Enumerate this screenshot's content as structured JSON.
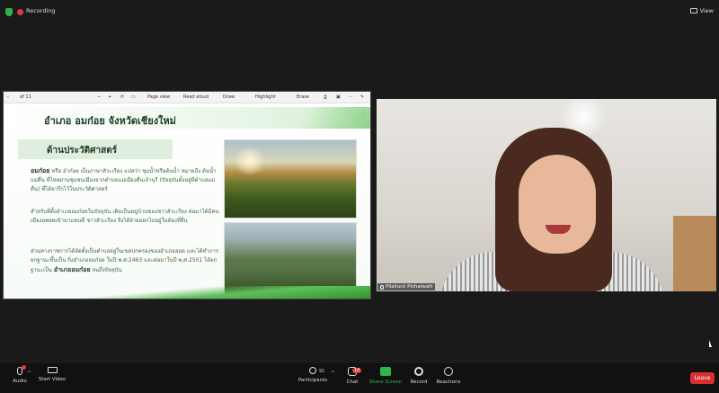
{
  "topbar": {
    "recording_label": "Recording",
    "view_label": "View"
  },
  "pdf_toolbar": {
    "page_indicator": "of 11",
    "page_view": "Page view",
    "read_aloud": "Read aloud",
    "draw": "Draw",
    "highlight": "Highlight",
    "erase": "Erase"
  },
  "slide": {
    "title": "อำเภอ อมก๋อย จังหวัดเชียงใหม่",
    "section": "ด้านประวัติศาสตร์",
    "para1_lead": "อมก๋อย",
    "para1": "หรือ อ๋าก๋อย เป็นภาษาลัวะเรียง แปลว่า ชุมน้ำหรือต้นน้ำ หมายถึง ต้นน้ำแม่ตื่น ที่ไหลผ่านชุมชนเมืองจากตำบลแม่เมืองตื่นเจ้าบุรี (ปัจจุบันตั้งอยู่ที่ตำบลแม่ตื่น) ที่ได้จารึกไว้ในประวัติศาสตร์",
    "para2": "สำหรับที่ตั้งอำเภออมก๋อยในปัจจุบัน เดิมเป็นหมู่บ้านของชาวลัวะเรียง ต่อมาได้มีคนเมืองอพยพเข้ามาแทนที่ ชาวลัวะเรียง จึงได้ย้ายออกไปอยู่ในท้องที่อื่น",
    "para3": "ส่วนทางราชการได้จัดตั้งเป็นตำบลอยู่ในเขตปกครองของอำเภอฮอด และได้ทำการยกฐานะขึ้นเป็น กิ่งอำเภออมก๋อย ในปี พ.ศ.2463 และต่อมาในปี พ.ศ.2501 ได้ยกฐานะเป็น",
    "para3_bold": "อำเภออมก๋อย",
    "para3_end": "จนถึงปัจจุบัน"
  },
  "webcam": {
    "participant_name": "Pilailuck Pichaiwatt"
  },
  "bottombar": {
    "audio": "Audio",
    "start_video": "Start Video",
    "participants": "Participants",
    "participants_count": "91",
    "chat": "Chat",
    "chat_badge": "10",
    "share_screen": "Share Screen",
    "record": "Record",
    "reactions": "Reactions",
    "leave": "Leave"
  },
  "colors": {
    "accent_green": "#2fb34a",
    "leave_red": "#d9302f",
    "recording_red": "#e23b3b"
  }
}
